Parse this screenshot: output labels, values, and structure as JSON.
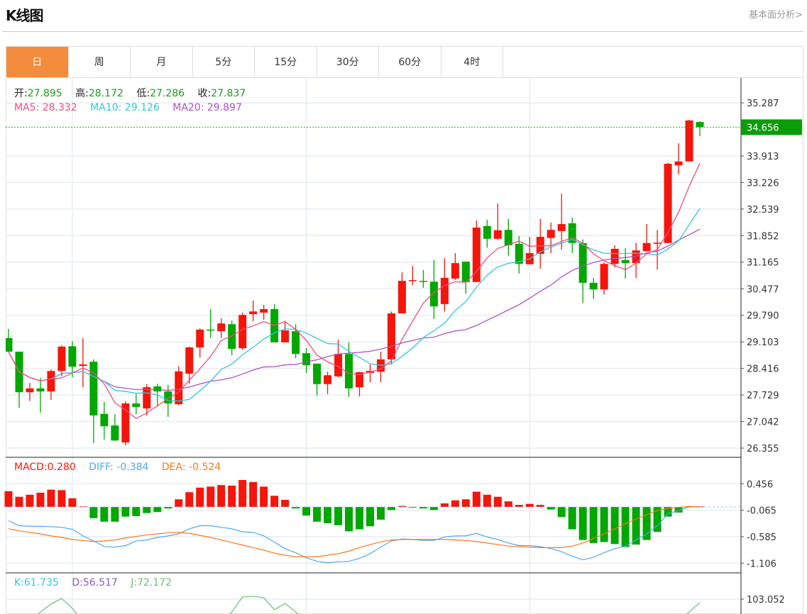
{
  "header": {
    "title": "K线图",
    "fundamental_link": "基本面分析>"
  },
  "tabs": [
    {
      "label": "日",
      "active": true
    },
    {
      "label": "周"
    },
    {
      "label": "月"
    },
    {
      "label": "5分"
    },
    {
      "label": "15分"
    },
    {
      "label": "30分"
    },
    {
      "label": "60分"
    },
    {
      "label": "4时"
    }
  ],
  "ohlc_legend": {
    "open_label": "开:",
    "open": "27.895",
    "high_label": "高:",
    "high": "28.172",
    "low_label": "低:",
    "low": "27.286",
    "close_label": "收:",
    "close": "27.837"
  },
  "ma_legend": {
    "ma5": "MA5: 28.332",
    "ma10": "MA10: 29.126",
    "ma20": "MA20: 29.897"
  },
  "macd_legend": {
    "macd": "MACD:0.280",
    "diff": "DIFF: -0.384",
    "dea": "DEA: -0.524"
  },
  "kdj_legend": {
    "k": "K:61.735",
    "d": "D:56.517",
    "j": "J:72.172"
  },
  "colors": {
    "up": "#f5150b",
    "down": "#00a800",
    "ma5": "#ef4d7d",
    "ma10": "#36c5e0",
    "ma20": "#b150c8",
    "diff": "#4ea8f5",
    "dea": "#ff7518",
    "k": "#36c5e0",
    "d": "#8a5cc9",
    "j": "#6cc070",
    "accent": "#f48c3e"
  },
  "chart_data": {
    "type": "candlestick",
    "price_axis": {
      "ticks": [
        "35.287",
        "33.913",
        "33.226",
        "32.539",
        "31.852",
        "31.165",
        "30.477",
        "29.790",
        "29.103",
        "28.416",
        "27.729",
        "27.042",
        "26.355"
      ],
      "range": [
        26.355,
        35.287
      ]
    },
    "last_price": "34.656",
    "candles": [
      [
        29.2,
        28.85,
        29.44,
        28.84
      ],
      [
        28.85,
        27.8,
        28.85,
        27.4
      ],
      [
        27.8,
        27.9,
        28.04,
        27.57
      ],
      [
        27.9,
        27.82,
        28.17,
        27.27
      ],
      [
        27.82,
        28.35,
        28.39,
        27.6
      ],
      [
        28.35,
        28.98,
        29.01,
        28.21
      ],
      [
        28.99,
        28.46,
        29.12,
        28.19
      ],
      [
        28.48,
        28.52,
        29.2,
        27.93
      ],
      [
        28.59,
        27.2,
        28.65,
        26.48
      ],
      [
        27.24,
        26.92,
        27.55,
        26.58
      ],
      [
        26.94,
        26.55,
        27.23,
        26.55
      ],
      [
        26.5,
        27.51,
        27.57,
        26.43
      ],
      [
        27.51,
        27.42,
        27.75,
        27.23
      ],
      [
        27.38,
        27.93,
        28.01,
        27.2
      ],
      [
        27.95,
        27.82,
        28.02,
        27.44
      ],
      [
        27.82,
        27.51,
        27.99,
        27.16
      ],
      [
        27.49,
        28.34,
        28.48,
        27.46
      ],
      [
        28.28,
        28.96,
        28.98,
        28.02
      ],
      [
        28.96,
        29.42,
        29.45,
        28.7
      ],
      [
        29.42,
        29.4,
        29.95,
        29.2
      ],
      [
        29.38,
        29.58,
        29.71,
        29.2
      ],
      [
        29.56,
        28.92,
        29.65,
        28.76
      ],
      [
        28.94,
        29.8,
        29.86,
        28.9
      ],
      [
        29.82,
        29.89,
        30.17,
        29.64
      ],
      [
        29.86,
        29.95,
        30.06,
        29.67
      ],
      [
        29.95,
        29.09,
        30.08,
        29.09
      ],
      [
        29.09,
        29.4,
        29.65,
        29.09
      ],
      [
        29.38,
        28.79,
        29.56,
        28.68
      ],
      [
        28.81,
        28.5,
        28.94,
        28.3
      ],
      [
        28.54,
        28.01,
        28.54,
        27.71
      ],
      [
        28.01,
        28.24,
        28.33,
        27.75
      ],
      [
        28.21,
        28.79,
        29.16,
        28.19
      ],
      [
        28.79,
        27.9,
        29.09,
        27.68
      ],
      [
        27.93,
        28.32,
        28.33,
        27.69
      ],
      [
        28.3,
        28.35,
        28.52,
        28.06
      ],
      [
        28.33,
        28.65,
        28.85,
        28.06
      ],
      [
        28.65,
        29.84,
        29.89,
        28.52
      ],
      [
        29.84,
        30.68,
        30.9,
        29.84
      ],
      [
        30.68,
        30.7,
        31.07,
        30.57
      ],
      [
        30.68,
        30.66,
        30.96,
        30.5
      ],
      [
        30.66,
        30.02,
        31.22,
        29.69
      ],
      [
        30.08,
        30.76,
        31.27,
        29.89
      ],
      [
        30.74,
        31.14,
        31.4,
        30.7
      ],
      [
        31.18,
        30.65,
        31.18,
        30.35
      ],
      [
        30.65,
        32.06,
        32.24,
        30.65
      ],
      [
        32.1,
        31.77,
        32.26,
        31.54
      ],
      [
        31.77,
        31.99,
        32.68,
        31.73
      ],
      [
        32.0,
        31.6,
        32.28,
        31.34
      ],
      [
        31.64,
        31.12,
        31.84,
        30.87
      ],
      [
        31.11,
        31.4,
        31.82,
        31.11
      ],
      [
        31.38,
        31.82,
        32.28,
        31.0
      ],
      [
        31.79,
        32.0,
        32.19,
        31.4
      ],
      [
        31.97,
        32.15,
        32.94,
        31.49
      ],
      [
        32.17,
        31.66,
        32.32,
        31.4
      ],
      [
        31.66,
        30.63,
        31.75,
        30.11
      ],
      [
        30.63,
        30.46,
        30.76,
        30.21
      ],
      [
        30.46,
        31.12,
        31.16,
        30.33
      ],
      [
        31.12,
        31.51,
        31.6,
        31.03
      ],
      [
        31.22,
        31.14,
        31.53,
        30.74
      ],
      [
        31.14,
        31.47,
        31.67,
        30.76
      ],
      [
        31.45,
        31.66,
        32.15,
        31.45
      ],
      [
        31.64,
        31.67,
        32.0,
        30.97
      ],
      [
        31.66,
        33.71,
        33.73,
        31.66
      ],
      [
        33.67,
        33.77,
        34.24,
        33.43
      ],
      [
        33.77,
        34.83,
        34.85,
        33.77
      ],
      [
        34.79,
        34.656,
        34.81,
        34.42
      ]
    ],
    "macd_axis": {
      "ticks": [
        "0.456",
        "-0.065",
        "-0.585",
        "-1.106"
      ]
    },
    "macd_hist": [
      0.31,
      0.2,
      0.24,
      0.28,
      0.34,
      0.33,
      0.17,
      0.01,
      -0.22,
      -0.29,
      -0.29,
      -0.19,
      -0.18,
      -0.12,
      -0.1,
      -0.03,
      0.15,
      0.29,
      0.38,
      0.4,
      0.43,
      0.42,
      0.53,
      0.49,
      0.4,
      0.22,
      0.14,
      -0.03,
      -0.17,
      -0.29,
      -0.32,
      -0.36,
      -0.48,
      -0.44,
      -0.38,
      -0.25,
      -0.06,
      0.02,
      0.0,
      -0.03,
      -0.06,
      0.07,
      0.13,
      0.15,
      0.3,
      0.24,
      0.2,
      0.11,
      0.04,
      0.06,
      0.04,
      -0.05,
      -0.2,
      -0.44,
      -0.65,
      -0.71,
      -0.69,
      -0.73,
      -0.79,
      -0.74,
      -0.65,
      -0.49,
      -0.19,
      -0.11,
      0.01,
      0.01
    ],
    "diff": [
      -0.27,
      -0.37,
      -0.38,
      -0.38,
      -0.39,
      -0.4,
      -0.44,
      -0.57,
      -0.67,
      -0.78,
      -0.79,
      -0.76,
      -0.67,
      -0.65,
      -0.6,
      -0.57,
      -0.53,
      -0.43,
      -0.37,
      -0.37,
      -0.4,
      -0.43,
      -0.49,
      -0.5,
      -0.57,
      -0.69,
      -0.82,
      -0.9,
      -1.0,
      -1.07,
      -1.1,
      -1.08,
      -1.07,
      -1.01,
      -0.92,
      -0.79,
      -0.67,
      -0.63,
      -0.64,
      -0.66,
      -0.66,
      -0.59,
      -0.57,
      -0.57,
      -0.52,
      -0.59,
      -0.64,
      -0.71,
      -0.76,
      -0.76,
      -0.78,
      -0.82,
      -0.88,
      -0.97,
      -1.04,
      -0.99,
      -0.9,
      -0.82,
      -0.77,
      -0.65,
      -0.53,
      -0.37,
      -0.13,
      -0.07,
      0.0,
      0.0
    ],
    "dea": [
      -0.43,
      -0.47,
      -0.5,
      -0.53,
      -0.57,
      -0.6,
      -0.64,
      -0.66,
      -0.68,
      -0.67,
      -0.65,
      -0.61,
      -0.58,
      -0.55,
      -0.53,
      -0.51,
      -0.5,
      -0.52,
      -0.56,
      -0.6,
      -0.65,
      -0.7,
      -0.75,
      -0.8,
      -0.85,
      -0.91,
      -0.95,
      -0.98,
      -0.98,
      -0.98,
      -0.95,
      -0.92,
      -0.87,
      -0.8,
      -0.74,
      -0.69,
      -0.65,
      -0.64,
      -0.64,
      -0.64,
      -0.64,
      -0.64,
      -0.65,
      -0.66,
      -0.68,
      -0.71,
      -0.74,
      -0.77,
      -0.78,
      -0.79,
      -0.8,
      -0.8,
      -0.8,
      -0.77,
      -0.71,
      -0.62,
      -0.53,
      -0.43,
      -0.33,
      -0.24,
      -0.15,
      -0.07,
      -0.03,
      -0.01,
      0.01,
      0.0
    ],
    "kdj_axis": {
      "ticks": [
        "103.052"
      ]
    },
    "j_visible": [
      null,
      null,
      null,
      85,
      96,
      104,
      90,
      null,
      null,
      null,
      null,
      null,
      null,
      null,
      null,
      null,
      null,
      null,
      null,
      null,
      null,
      85,
      106,
      107,
      105,
      88,
      97,
      85,
      null,
      null,
      null,
      null,
      null,
      null,
      null,
      null,
      null,
      null,
      null,
      null,
      null,
      null,
      null,
      null,
      null,
      null,
      null,
      null,
      null,
      null,
      null,
      null,
      null,
      null,
      null,
      null,
      null,
      null,
      null,
      null,
      null,
      null,
      null,
      null,
      85,
      98
    ]
  }
}
